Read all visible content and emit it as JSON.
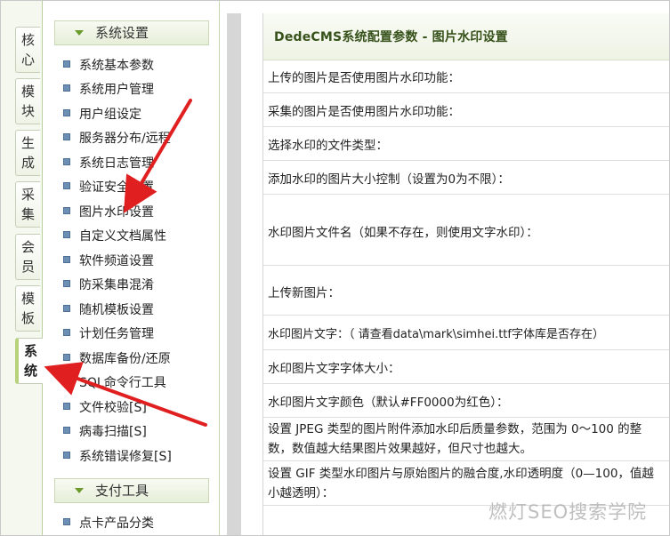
{
  "tabs": [
    {
      "label": "核\n心",
      "active": false
    },
    {
      "label": "模\n块",
      "active": false
    },
    {
      "label": "生\n成",
      "active": false
    },
    {
      "label": "采\n集",
      "active": false
    },
    {
      "label": "会\n员",
      "active": false
    },
    {
      "label": "模\n板",
      "active": false
    },
    {
      "label": "系\n统",
      "active": true
    }
  ],
  "menu": {
    "section1_title": "系统设置",
    "items": [
      "系统基本参数",
      "系统用户管理",
      "用户组设定",
      "服务器分布/远程",
      "系统日志管理",
      "验证安全设置",
      "图片水印设置",
      "自定义文档属性",
      "软件频道设置",
      "防采集串混淆",
      "随机模板设置",
      "计划任务管理",
      "数据库备份/还原",
      "SQL命令行工具",
      "文件校验[S]",
      "病毒扫描[S]",
      "系统错误修复[S]"
    ],
    "section2_title": "支付工具",
    "section2_items": [
      "点卡产品分类"
    ]
  },
  "content": {
    "title": "DedeCMS系统配置参数 - 图片水印设置",
    "rows": [
      "上传的图片是否使用图片水印功能：",
      "采集的图片是否使用图片水印功能：",
      "选择水印的文件类型：",
      "添加水印的图片大小控制（设置为0为不限）：",
      "水印图片文件名（如果不存在，则使用文字水印）：",
      "上传新图片：",
      "水印图片文字：（  请查看data\\mark\\simhei.ttf字体库是否存在）",
      "水印图片文字字体大小：",
      "水印图片文字颜色（默认#FF0000为红色）：",
      "设置 JPEG 类型的图片附件添加水印后质量参数，范围为 0～100 的整数，数值越大结果图片效果越好，但尺寸也越大。",
      "设置 GIF 类型水印图片与原始图片的融合度,水印透明度（0—100，值越小越透明）："
    ]
  },
  "watermark": "燃灯SEO搜索学院",
  "colors": {
    "arrow": "#e02020",
    "title_text": "#36511a",
    "bullet": "#6c8fb3",
    "active_tab_accent": "#b7d27a"
  }
}
